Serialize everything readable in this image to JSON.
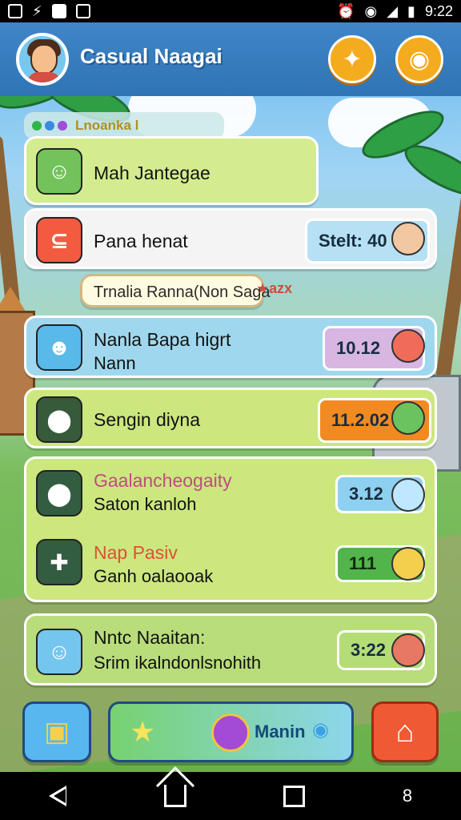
{
  "status_bar": {
    "time": "9:22"
  },
  "header": {
    "title": "Casual Naagai"
  },
  "legend": {
    "text": "Lnoanka l"
  },
  "rows": [
    {
      "line1": "Mah Jantegae",
      "line2": ""
    },
    {
      "line1": "Pana henat",
      "line2": "",
      "value": "Stelt: 40"
    },
    {
      "line1": "Trnalia Ranna(Non Saga",
      "line2": "",
      "badge": "azx"
    },
    {
      "line1": "Nanla Bapa higrt",
      "line2": "Nann",
      "value": "10.12"
    },
    {
      "line1": "Sengin diyna",
      "line2": "",
      "value": "11.2.02"
    },
    {
      "line1": "Gaalancheogaity",
      "line2": "Saton kanloh",
      "value": "3.12"
    },
    {
      "line1": "Nap Pasiv",
      "line2": "Ganh oalaooak",
      "value": "111"
    },
    {
      "line1": "Nntc Naaitan:",
      "line2": "Srim ikalndonlsnohith",
      "value": "3:22"
    }
  ],
  "bottom": {
    "middle_label": "Manin"
  },
  "android_nav": {
    "extra": "8"
  },
  "colors": {
    "header": "#3f86c8",
    "panel_green": "#cbe77e",
    "panel_blue": "#b7e3f1",
    "accent_orange": "#f5ab1e",
    "value_purple": "#d7b6e2",
    "value_orange": "#f28a22",
    "value_blue": "#8ed0ef",
    "value_green": "#53b44b"
  }
}
